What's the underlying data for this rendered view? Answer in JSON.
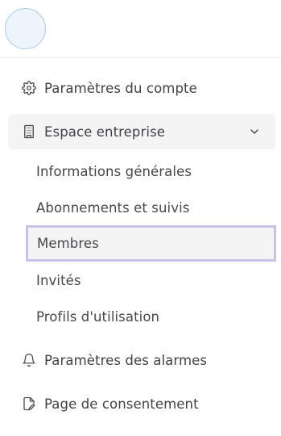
{
  "menu": {
    "items": [
      {
        "label": "Paramètres du compte",
        "icon": "gear-icon"
      },
      {
        "label": "Espace entreprise",
        "icon": "building-icon",
        "expanded": true
      },
      {
        "label": "Paramètres des alarmes",
        "icon": "bell-icon"
      },
      {
        "label": "Page de consentement",
        "icon": "file-edit-icon"
      }
    ],
    "subitems": [
      {
        "label": "Informations générales"
      },
      {
        "label": "Abonnements et suivis"
      },
      {
        "label": "Membres",
        "active": true
      },
      {
        "label": "Invités"
      },
      {
        "label": "Profils d'utilisation"
      }
    ]
  },
  "colors": {
    "active_border": "#c7c3e6",
    "active_background": "#f4f4f5",
    "text": "#3f4148",
    "avatar_border": "#a9c8ee"
  }
}
